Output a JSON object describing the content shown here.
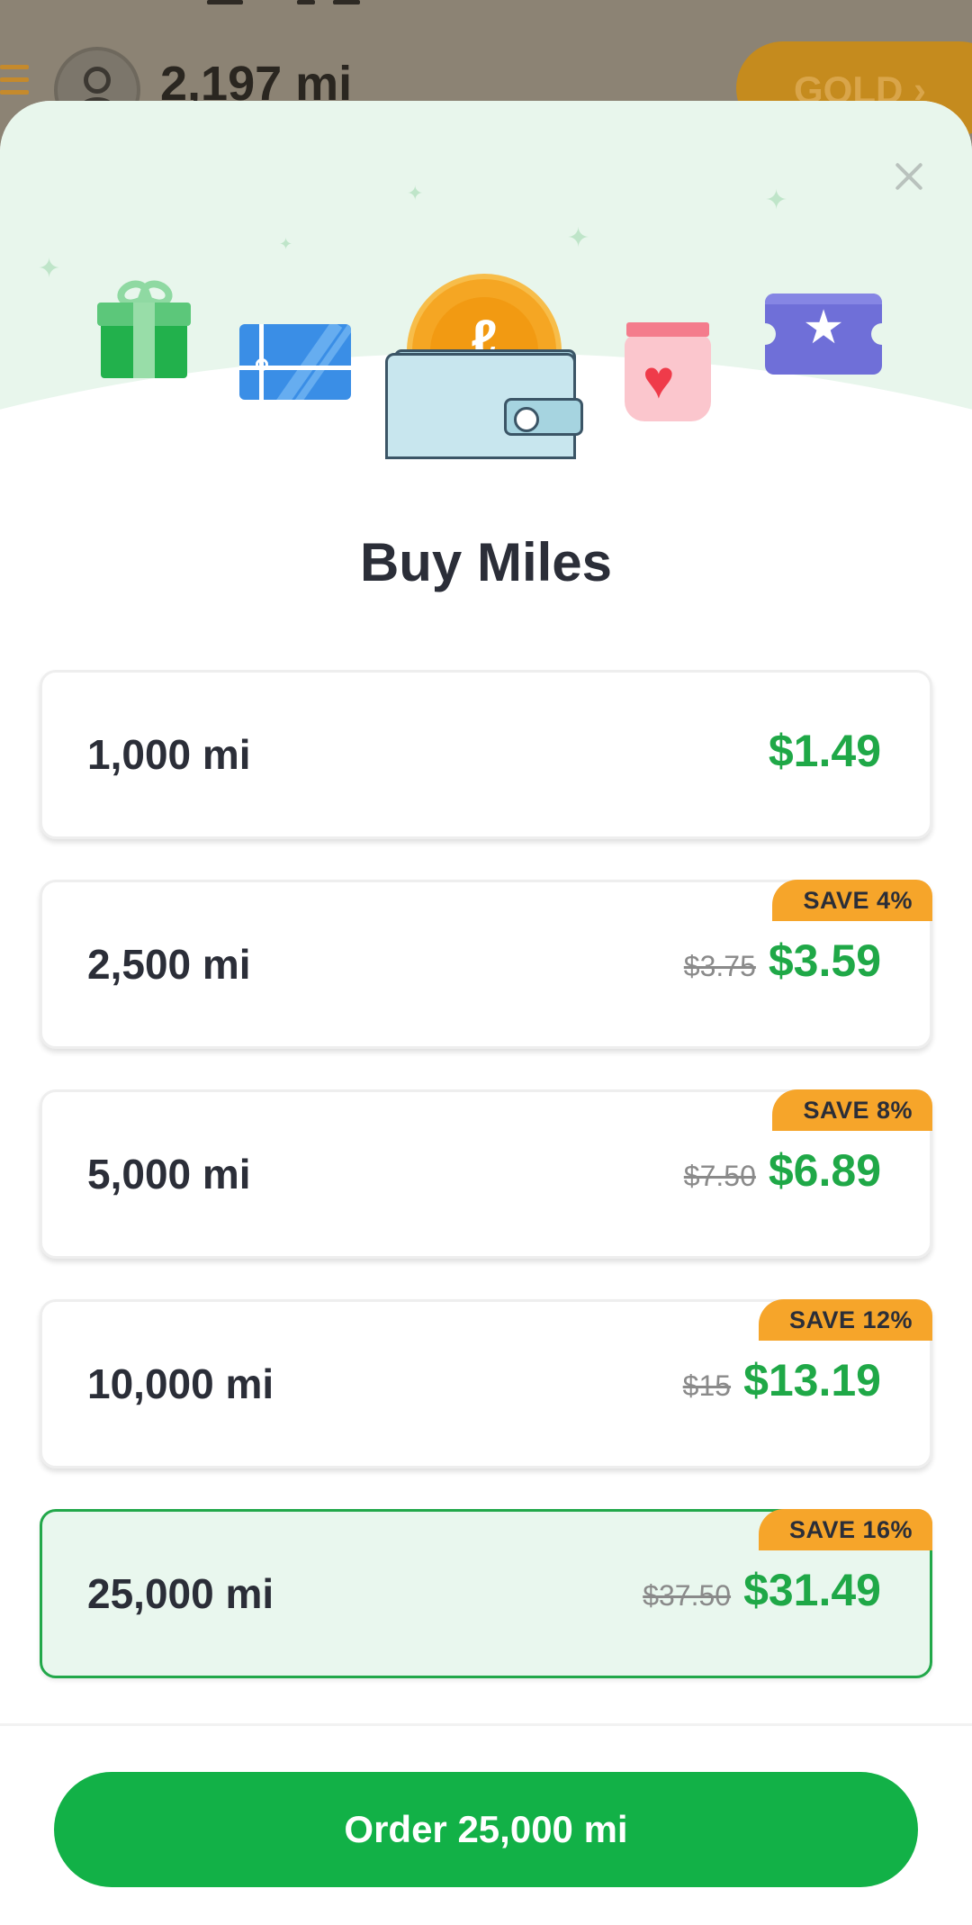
{
  "background": {
    "miles": "2,197 mi",
    "tier_button": "GOLD ›"
  },
  "sheet": {
    "title": "Buy Miles",
    "close_icon": "close-icon",
    "illustration_icons": [
      "gift-icon",
      "gift-card-icon",
      "wallet-coin-icon",
      "heart-jar-icon",
      "star-ticket-icon"
    ],
    "options": [
      {
        "miles": "1,000 mi",
        "old_price": "",
        "price": "$1.49",
        "badge": "",
        "selected": false
      },
      {
        "miles": "2,500 mi",
        "old_price": "$3.75",
        "price": "$3.59",
        "badge": "SAVE 4%",
        "selected": false
      },
      {
        "miles": "5,000 mi",
        "old_price": "$7.50",
        "price": "$6.89",
        "badge": "SAVE 8%",
        "selected": false
      },
      {
        "miles": "10,000 mi",
        "old_price": "$15",
        "price": "$13.19",
        "badge": "SAVE 12%",
        "selected": false
      },
      {
        "miles": "25,000 mi",
        "old_price": "$37.50",
        "price": "$31.49",
        "badge": "SAVE 16%",
        "selected": true
      }
    ],
    "order_button": "Order 25,000 mi"
  },
  "colors": {
    "accent_green": "#12b147",
    "price_green": "#1fa847",
    "badge_orange": "#f6a52a",
    "selected_bg": "#e9f7ee",
    "hero_bg": "#e8f6ec",
    "text_dark": "#2b2e38"
  }
}
